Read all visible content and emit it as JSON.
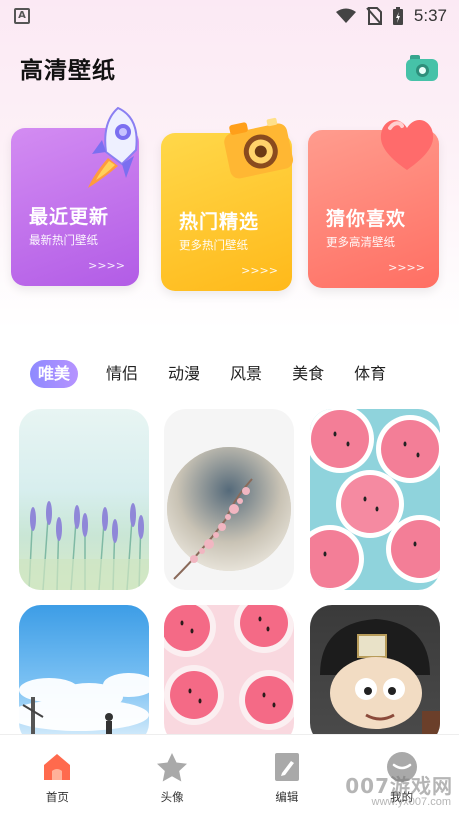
{
  "status_bar": {
    "notification_icon": "a-app-icon",
    "time": "5:37"
  },
  "header": {
    "title": "高清壁纸"
  },
  "feature_cards": [
    {
      "title": "最近更新",
      "subtitle": "最新热门壁纸",
      "arrows": ">>>>",
      "color": "#c174ee"
    },
    {
      "title": "热门精选",
      "subtitle": "更多热门壁纸",
      "arrows": ">>>>",
      "color": "#ffc82e"
    },
    {
      "title": "猜你喜欢",
      "subtitle": "更多高清壁纸",
      "arrows": ">>>>",
      "color": "#ff8577"
    }
  ],
  "categories": {
    "active": "唯美",
    "items": [
      "唯美",
      "情侣",
      "动漫",
      "风景",
      "美食",
      "体育"
    ]
  },
  "bottom_nav": {
    "items": [
      {
        "label": "首页",
        "icon": "home-icon",
        "active": true
      },
      {
        "label": "头像",
        "icon": "star-icon",
        "active": false
      },
      {
        "label": "编辑",
        "icon": "edit-icon",
        "active": false
      },
      {
        "label": "我的",
        "icon": "profile-icon",
        "active": false
      }
    ]
  },
  "watermark": {
    "text": "007游戏网",
    "url": "www.yx007.com"
  },
  "colors": {
    "accent": "#9b8cff",
    "home_active": "#ff6a4d"
  }
}
